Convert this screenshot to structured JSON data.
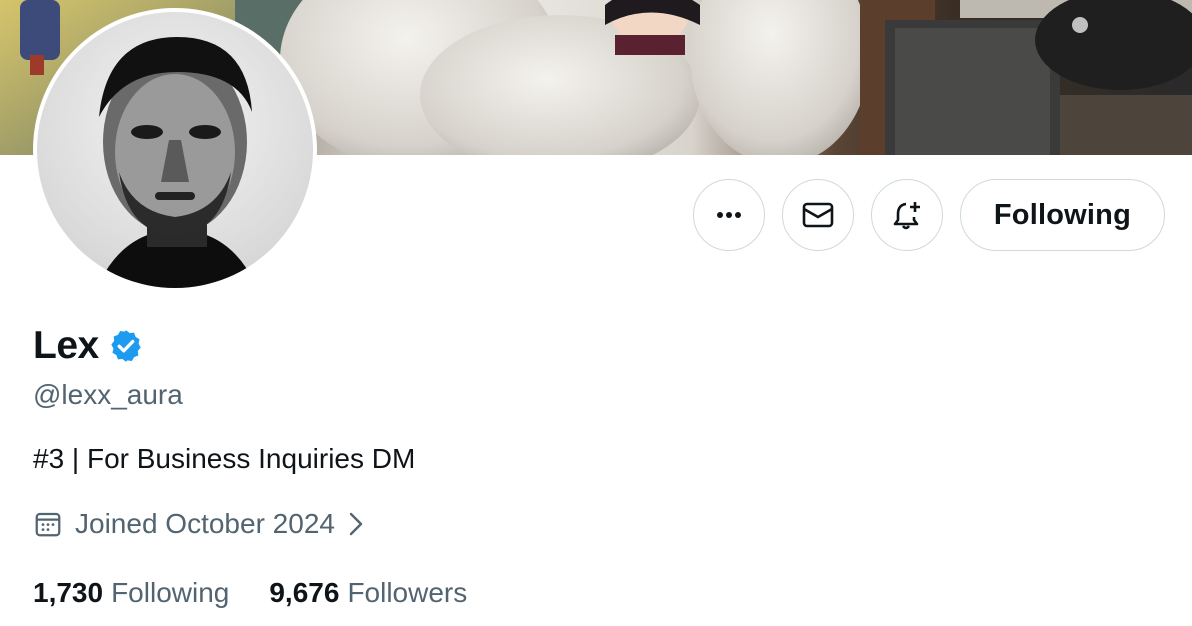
{
  "profile": {
    "display_name": "Lex",
    "verified": true,
    "handle": "@lexx_aura",
    "bio": "#3 | For Business Inquiries DM",
    "joined": "Joined October 2024"
  },
  "actions": {
    "more_icon": "more-horizontal-icon",
    "message_icon": "envelope-icon",
    "notify_icon": "bell-plus-icon",
    "follow_label": "Following"
  },
  "stats": {
    "following_count": "1,730",
    "following_label": "Following",
    "followers_count": "9,676",
    "followers_label": "Followers"
  },
  "colors": {
    "text_primary": "#0f1419",
    "text_secondary": "#536471",
    "verified_blue": "#1d9bf0",
    "border": "#cfd9de"
  }
}
